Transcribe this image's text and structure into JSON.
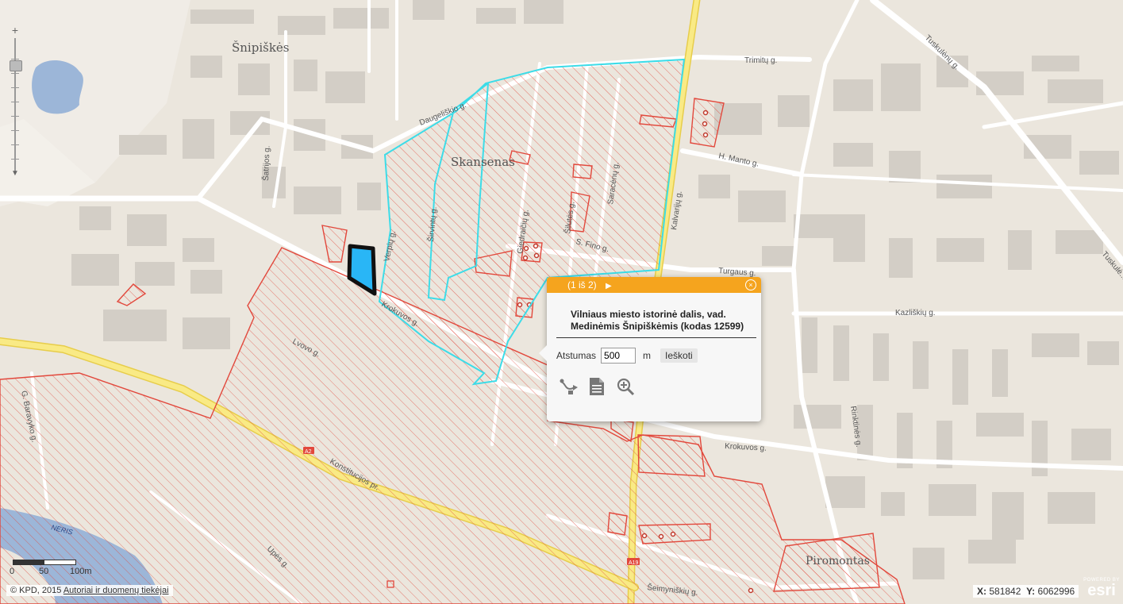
{
  "map": {
    "labels": {
      "snipiskes": "Šnipiškės",
      "skansenas": "Skansenas",
      "piromontas": "Piromontas",
      "neris": "NERIS"
    },
    "streets": {
      "daugeliskio": "Daugeliškio g.",
      "satrijos": "Šatrijos g.",
      "sirvintu": "Širvintų g.",
      "verpriu": "Verpių g.",
      "giedraiciu": "Giedraičių g.",
      "silutes": "Šilutės g.",
      "saraceno": "Saracėnų g.",
      "s_fino": "S. Fino g.",
      "kalvariju": "Kalvarijų g.",
      "trimitu": "Trimitų g.",
      "h_manto": "H. Manto g.",
      "turgaus": "Turgaus g.",
      "krokuvos": "Krokuvos g.",
      "krokuvos2": "Krokuvos g.",
      "lvovo": "Lvovo g.",
      "konstitucijos": "Konstitucijos pr.",
      "g_baravyko": "G. Baravyko g.",
      "upes": "Upės g.",
      "seimyniskiu": "Šeimyniškių g.",
      "kazliskiu": "Kazliškių g.",
      "rinktines": "Rinktinės g.",
      "tuskulenu": "Tuskulėnų g.",
      "tuskulenu2": "Tuskulė..."
    },
    "road_badges": {
      "a2a": "A2",
      "a2b": "A19"
    }
  },
  "zoom": {
    "plus": "+",
    "minus": "▼"
  },
  "popup": {
    "pager": "(1 iš 2)",
    "next": "▶",
    "close": "×",
    "title": "Vilniaus miesto istorinė dalis, vad. Medinėmis Šnipiškėmis (kodas 12599)",
    "distance_label": "Atstumas",
    "distance_value": "500",
    "distance_unit": "m",
    "search_button": "Ieškoti"
  },
  "scalebar": {
    "zero": "0",
    "mid": "50",
    "max": "100m"
  },
  "attribution": {
    "prefix": "© KPD, 2015",
    "link": "Autoriai ir duomenų tiekėjai"
  },
  "coords": {
    "x_label": "X:",
    "x_value": "581842",
    "y_label": "Y:",
    "y_value": "6062996"
  },
  "esri": {
    "powered": "POWERED BY",
    "name": "esri"
  },
  "colors": {
    "heritage_red": "#e2483c",
    "selection_cyan": "#3cdce8",
    "highlight_blue": "#29b6f6",
    "popup_header": "#f5a41e"
  }
}
